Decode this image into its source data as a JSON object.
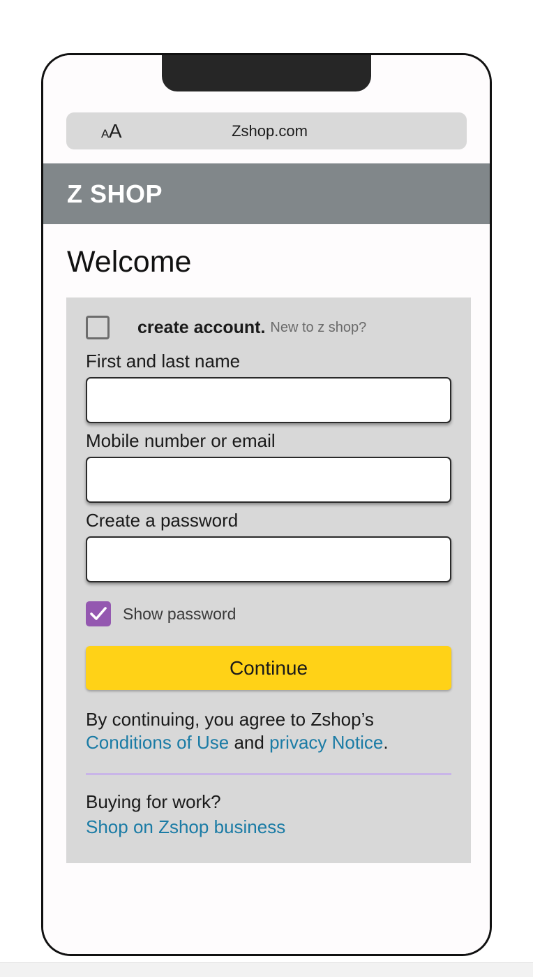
{
  "browser": {
    "text_size_icon_small": "A",
    "text_size_icon_large": "A",
    "url": "Zshop.com"
  },
  "site_header": {
    "brand": "Z SHOP"
  },
  "page": {
    "title": "Welcome"
  },
  "form": {
    "create_account": {
      "checked": false,
      "label": "create account.",
      "sub_label": "New to z shop?"
    },
    "fields": [
      {
        "label": "First and last name",
        "value": "",
        "placeholder": ""
      },
      {
        "label": "Mobile number or email",
        "value": "",
        "placeholder": ""
      },
      {
        "label": "Create a password",
        "value": "",
        "placeholder": ""
      }
    ],
    "show_password": {
      "checked": true,
      "label": "Show password"
    },
    "continue_label": "Continue"
  },
  "legal": {
    "prefix": "By continuing, you agree to Zshop’s ",
    "link_conditions": "Conditions of Use",
    "middle": " and ",
    "link_privacy": "privacy Notice",
    "suffix": "."
  },
  "business": {
    "heading": "Buying for work?",
    "link": "Shop on Zshop business"
  },
  "colors": {
    "header_grey": "#81878a",
    "card_grey": "#d8d8d8",
    "accent_yellow": "#FFD217",
    "link_blue": "#1a7ba5",
    "checkbox_purple": "#9458b0",
    "divider_lavender": "#c9b5e8"
  }
}
